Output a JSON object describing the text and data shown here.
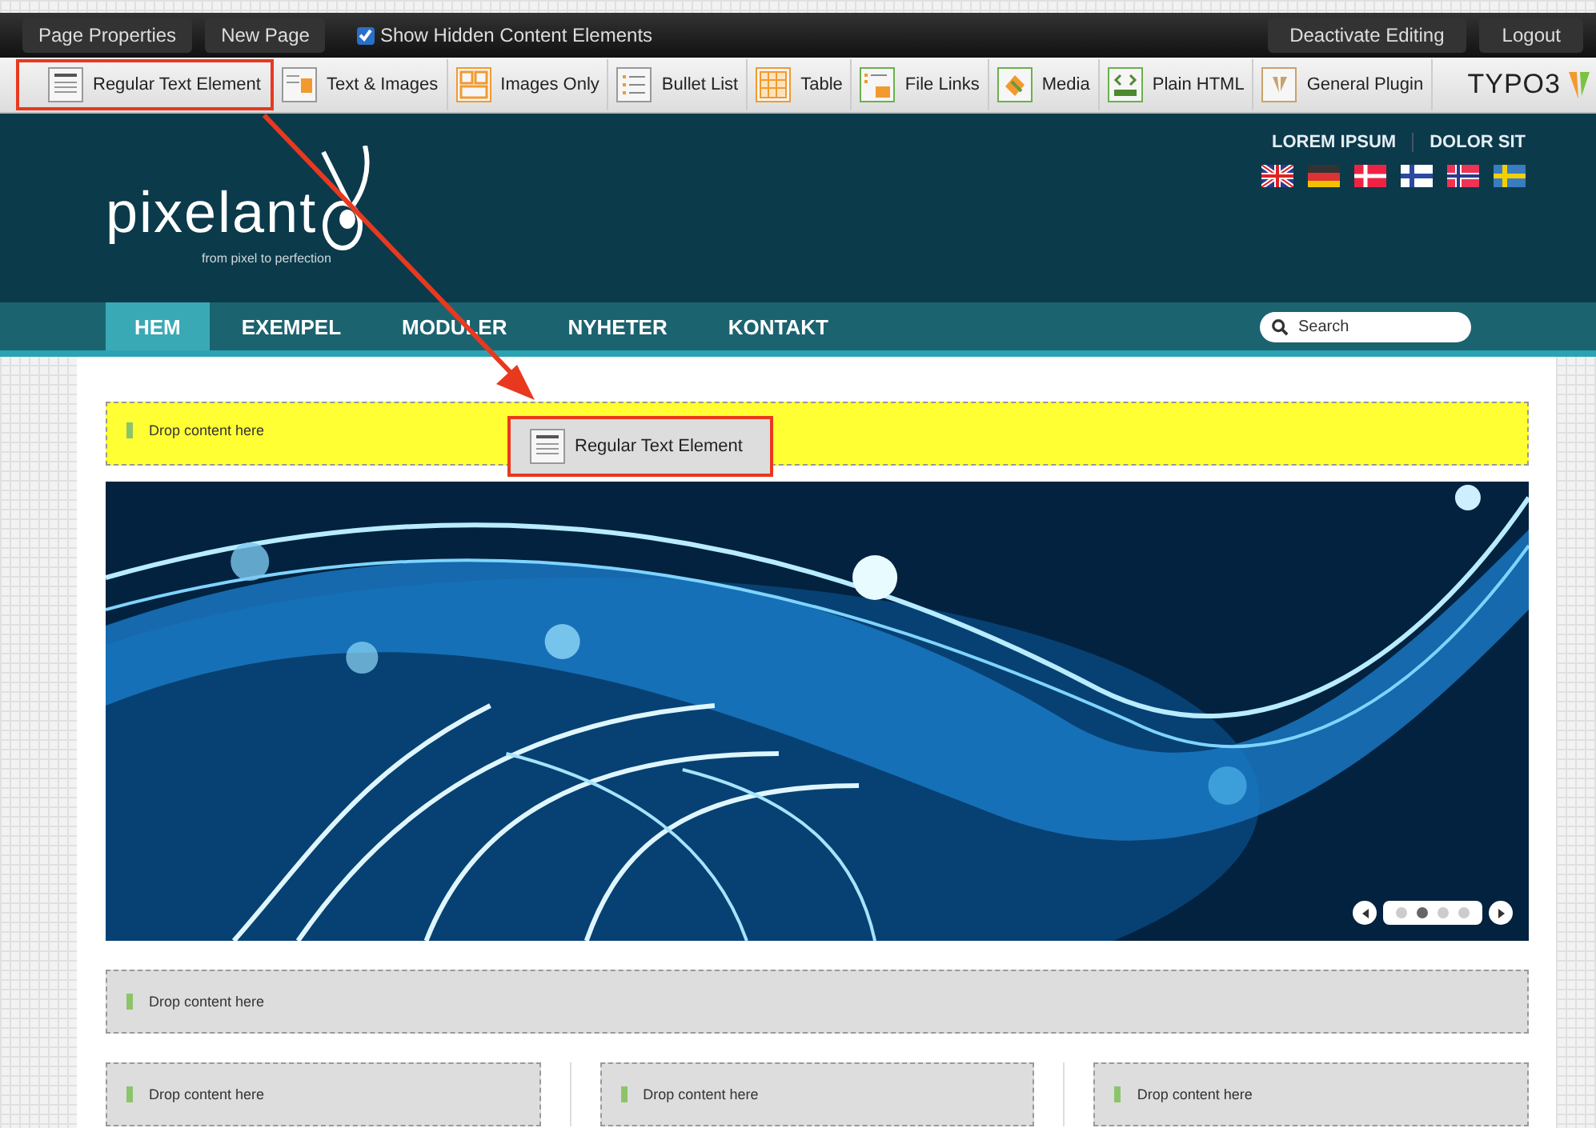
{
  "topbar": {
    "left_buttons": [
      "Page Properties",
      "New Page"
    ],
    "show_hidden": {
      "label": "Show Hidden Content Elements",
      "checked": true
    },
    "right_buttons": [
      "Deactivate Editing",
      "Logout"
    ]
  },
  "toolbar": {
    "items": [
      {
        "label": "Regular Text Element",
        "kind": "text",
        "selected": true
      },
      {
        "label": "Text & Images",
        "kind": "textimage",
        "selected": false
      },
      {
        "label": "Images Only",
        "kind": "images",
        "selected": false
      },
      {
        "label": "Bullet List",
        "kind": "bullets",
        "selected": false
      },
      {
        "label": "Table",
        "kind": "table",
        "selected": false
      },
      {
        "label": "File Links",
        "kind": "files",
        "selected": false
      },
      {
        "label": "Media",
        "kind": "media",
        "selected": false
      },
      {
        "label": "Plain HTML",
        "kind": "html",
        "selected": false
      },
      {
        "label": "General Plugin",
        "kind": "plugin",
        "selected": false
      }
    ],
    "brand": "TYPO3"
  },
  "header": {
    "logo": "pixelant",
    "tagline": "from pixel to perfection",
    "links": [
      "LOREM IPSUM",
      "DOLOR SIT"
    ]
  },
  "nav": {
    "items": [
      {
        "label": "HEM",
        "selected": true
      },
      {
        "label": "EXEMPEL",
        "selected": false
      },
      {
        "label": "MODULER",
        "selected": false
      },
      {
        "label": "NYHETER",
        "selected": false
      },
      {
        "label": "KONTAKT",
        "selected": false
      }
    ],
    "search": {
      "placeholder": "Search"
    }
  },
  "drop_zones": {
    "top": {
      "label": "Drop content here",
      "highlighted": true
    },
    "middle": {
      "label": "Drop content here",
      "highlighted": false
    },
    "columns": [
      {
        "label": "Drop content here",
        "highlighted": false
      },
      {
        "label": "Drop content here",
        "highlighted": false
      },
      {
        "label": "Drop content here",
        "highlighted": false
      }
    ]
  },
  "drag_ghost": {
    "label": "Regular Text Element"
  },
  "slider": {
    "dots": [
      {
        "selected": false
      },
      {
        "selected": true
      },
      {
        "selected": false
      },
      {
        "selected": false
      }
    ]
  }
}
